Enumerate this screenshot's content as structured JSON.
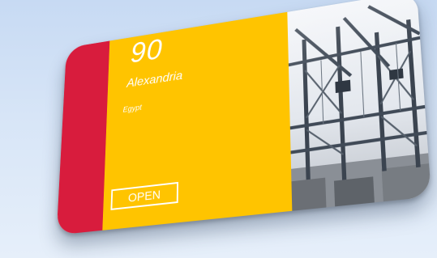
{
  "card": {
    "count": "90",
    "city": "Alexandria",
    "country": "Egypt",
    "open_label": "OPEN",
    "photo_icon": "port-cranes-image"
  },
  "colors": {
    "background": "#d3e2f6",
    "red_stripe": "#d81c3d",
    "yellow_panel": "#ffc400",
    "text": "#ffffff"
  }
}
